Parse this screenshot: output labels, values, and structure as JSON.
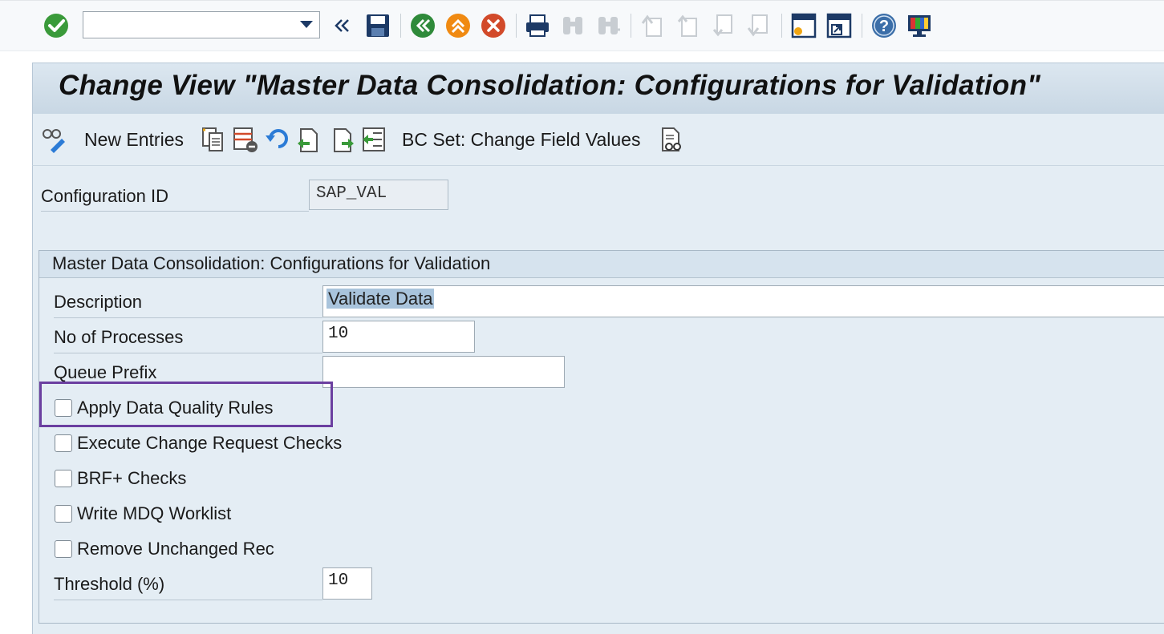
{
  "system_toolbar": {
    "command_field": {
      "value": "",
      "placeholder": ""
    },
    "icons": [
      "enter-icon",
      "back-arrows-icon",
      "save-icon",
      "back-icon",
      "exit-icon",
      "cancel-icon",
      "print-icon",
      "find-icon",
      "find-next-icon",
      "first-page-icon",
      "previous-page-icon",
      "next-page-icon",
      "last-page-icon",
      "create-session-icon",
      "shortcut-icon",
      "help-icon",
      "customize-layout-icon"
    ],
    "colors": {
      "enter": "#3a9a3a",
      "back": "#2f8a3a",
      "exit": "#f08a12",
      "cancel": "#d24a2a",
      "nav": "#1d3a66"
    }
  },
  "title": "Change View \"Master Data Consolidation: Configurations for Validation\"",
  "app_toolbar": {
    "new_entries": "New Entries",
    "bc_set": "BC Set: Change Field Values",
    "icons": [
      "display-change-icon",
      "copy-icon",
      "delete-icon",
      "undo-icon",
      "select-all-icon",
      "select-block-icon",
      "deselect-all-icon",
      "bc-set-display-icon"
    ]
  },
  "header_fields": {
    "config_id_label": "Configuration ID",
    "config_id_value": "SAP_VAL"
  },
  "group": {
    "title": "Master Data Consolidation: Configurations for Validation",
    "description_label": "Description",
    "description_value": "Validate Data",
    "processes_label": "No of Processes",
    "processes_value": "10",
    "queue_prefix_label": "Queue Prefix",
    "queue_prefix_value": "",
    "checkboxes": [
      {
        "label": "Apply Data Quality Rules",
        "checked": false
      },
      {
        "label": "Execute Change Request Checks",
        "checked": false
      },
      {
        "label": "BRF+ Checks",
        "checked": false
      },
      {
        "label": "Write MDQ Worklist",
        "checked": false
      },
      {
        "label": "Remove Unchanged Rec",
        "checked": false
      }
    ],
    "threshold_label": "Threshold (%)",
    "threshold_value": "10"
  },
  "highlight_color": "#6b3fa0"
}
